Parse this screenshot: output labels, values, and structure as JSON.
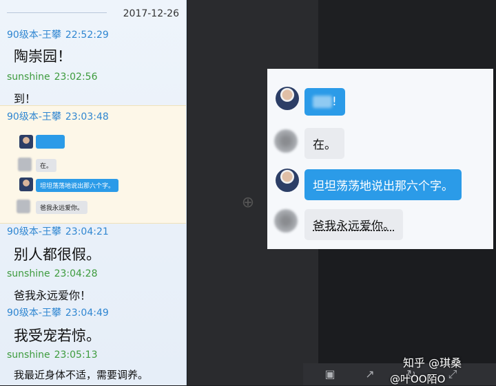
{
  "history": {
    "date": "2017-12-26",
    "entries": [
      {
        "name": "90级本-王攀",
        "time": "22:52:29",
        "text": "陶崇园！"
      },
      {
        "name": "sunshine",
        "time": "23:02:56",
        "text": "到！"
      },
      {
        "name": "90级本-王攀",
        "time": "23:03:48"
      },
      {
        "name": "90级本-王攀",
        "time": "23:04:21",
        "text": "别人都很假。"
      },
      {
        "name": "sunshine",
        "time": "23:04:28",
        "text": "爸我永远爱你！"
      },
      {
        "name": "90级本-王攀",
        "time": "23:04:49",
        "text": "我受宠若惊。"
      },
      {
        "name": "sunshine",
        "time": "23:05:13",
        "text": "我最近身体不适，需要调养。"
      }
    ],
    "thumb": [
      "在。",
      "坦坦荡荡地说出那六个字。",
      "爸我永远爱你。"
    ]
  },
  "zoomed_chat": {
    "messages": [
      {
        "side": "left",
        "avatar": "teacher-avatar",
        "text": "!",
        "color": "blue"
      },
      {
        "side": "left",
        "avatar": "student-avatar",
        "text": "在。",
        "color": "grey"
      },
      {
        "side": "left",
        "avatar": "teacher-avatar",
        "text": "坦坦荡荡地说出那六个字。",
        "color": "blue"
      },
      {
        "side": "left",
        "avatar": "student-avatar",
        "text": "爸我永远爱你。",
        "color": "grey"
      }
    ]
  },
  "watermark": {
    "zhihu": "知乎 @琪桑",
    "weibo": "@叶OO陌O"
  },
  "icons": [
    "zoom-in-icon",
    "save-icon",
    "share-icon",
    "rotate-icon",
    "fullscreen-icon"
  ],
  "colors": {
    "name_blue": "#2f86d1",
    "name_green": "#3d9b3d",
    "bubble_blue": "#2b9be8"
  }
}
